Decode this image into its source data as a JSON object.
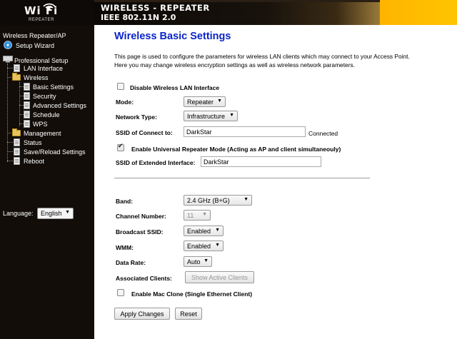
{
  "header": {
    "logo_text": "Wi Fi",
    "logo_sub": "REPEATER",
    "banner_line1": "WIRELESS - REPEATER",
    "banner_line2": "IEEE 802.11N 2.0"
  },
  "sidebar": {
    "root": "Wireless Repeater/AP",
    "setup_wizard": "Setup Wizard",
    "professional_setup": "Professional Setup",
    "lan_interface": "LAN Interface",
    "wireless": "Wireless",
    "basic_settings": "Basic Settings",
    "security": "Security",
    "advanced_settings": "Advanced Settings",
    "schedule": "Schedule",
    "wps": "WPS",
    "management": "Management",
    "status": "Status",
    "save_reload": "Save/Reload Settings",
    "reboot": "Reboot",
    "language_label": "Language:",
    "language_value": "English"
  },
  "main": {
    "title": "Wireless Basic Settings",
    "desc_line1": "This page is used to configure the parameters for wireless LAN clients which may connect to your Access Point.",
    "desc_line2": "Here you may change wireless encryption settings as well as wireless network parameters.",
    "disable_label": "Disable Wireless LAN Interface",
    "disable_checked": false,
    "mode_label": "Mode:",
    "mode_value": "Repeater",
    "network_type_label": "Network Type:",
    "network_type_value": "Infrastructure",
    "ssid_connect_label": "SSID of Connect to:",
    "ssid_connect_value": "DarkStar",
    "connected_text": "Connected",
    "universal_label": "Enable Universal Repeater Mode (Acting as AP and client simultaneouly)",
    "universal_checked": true,
    "ssid_ext_label": "SSID of Extended Interface:",
    "ssid_ext_value": "DarkStar",
    "band_label": "Band:",
    "band_value": "2.4 GHz (B+G)",
    "channel_label": "Channel Number:",
    "channel_value": "11",
    "broadcast_label": "Broadcast SSID:",
    "broadcast_value": "Enabled",
    "wmm_label": "WMM:",
    "wmm_value": "Enabled",
    "data_rate_label": "Data Rate:",
    "data_rate_value": "Auto",
    "assoc_label": "Associated Clients:",
    "show_clients_button": "Show Active Clients",
    "mac_clone_label": "Enable Mac Clone (Single Ethernet Client)",
    "mac_clone_checked": false,
    "apply_button": "Apply Changes",
    "reset_button": "Reset"
  },
  "colors": {
    "title_blue": "#0a24c8",
    "sidebar_bg": "#120d09",
    "banner_gold": "#ffc400"
  }
}
